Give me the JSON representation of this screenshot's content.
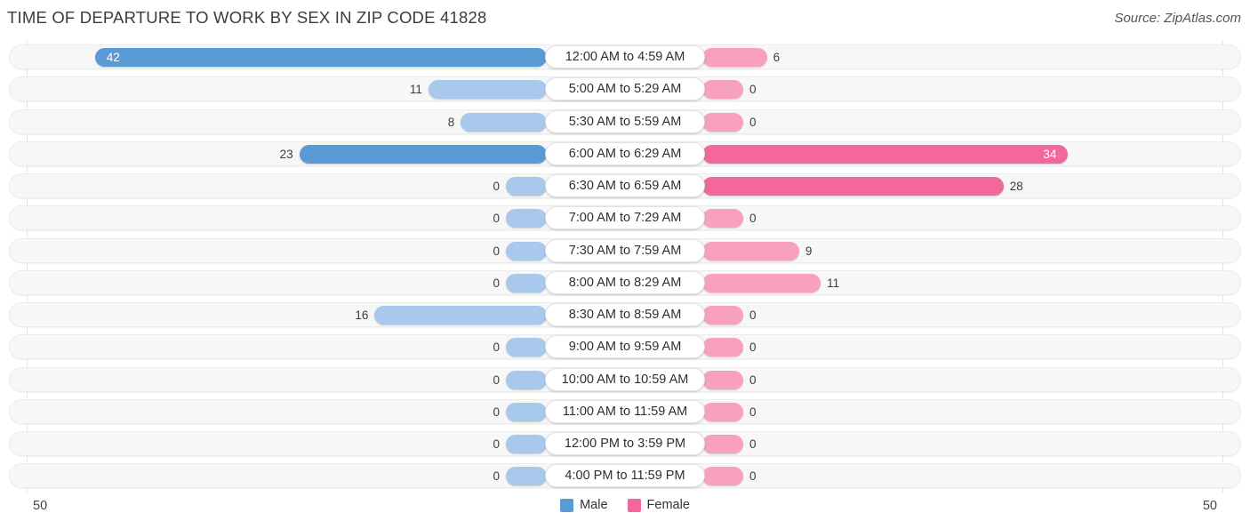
{
  "header": {
    "title": "TIME OF DEPARTURE TO WORK BY SEX IN ZIP CODE 41828",
    "source": "Source: ZipAtlas.com"
  },
  "legend": {
    "male_label": "Male",
    "female_label": "Female",
    "male_color": "#5B9BD5",
    "female_color": "#F2689C"
  },
  "axis": {
    "left_end": "50",
    "right_end": "50"
  },
  "colors": {
    "male_strong": "#5B9BD5",
    "male_light": "#A8C8EC",
    "female_strong": "#F2689C",
    "female_light": "#F8A0BF",
    "track": "#f7f7f7",
    "label_capsule": "#ffffff"
  },
  "chart_data": {
    "type": "bar",
    "orientation": "horizontal-diverging",
    "title": "TIME OF DEPARTURE TO WORK BY SEX IN ZIP CODE 41828",
    "xlabel": "",
    "ylabel": "",
    "xlim": [
      50,
      50
    ],
    "axis_max": 50,
    "grid": false,
    "legend_position": "bottom-center",
    "categories": [
      "12:00 AM to 4:59 AM",
      "5:00 AM to 5:29 AM",
      "5:30 AM to 5:59 AM",
      "6:00 AM to 6:29 AM",
      "6:30 AM to 6:59 AM",
      "7:00 AM to 7:29 AM",
      "7:30 AM to 7:59 AM",
      "8:00 AM to 8:29 AM",
      "8:30 AM to 8:59 AM",
      "9:00 AM to 9:59 AM",
      "10:00 AM to 10:59 AM",
      "11:00 AM to 11:59 AM",
      "12:00 PM to 3:59 PM",
      "4:00 PM to 11:59 PM"
    ],
    "series": [
      {
        "name": "Male",
        "color": "#5B9BD5",
        "values": [
          42,
          11,
          8,
          23,
          0,
          0,
          0,
          0,
          16,
          0,
          0,
          0,
          0,
          0
        ]
      },
      {
        "name": "Female",
        "color": "#F2689C",
        "values": [
          6,
          0,
          0,
          34,
          28,
          0,
          9,
          11,
          0,
          0,
          0,
          0,
          0,
          0
        ]
      }
    ]
  }
}
